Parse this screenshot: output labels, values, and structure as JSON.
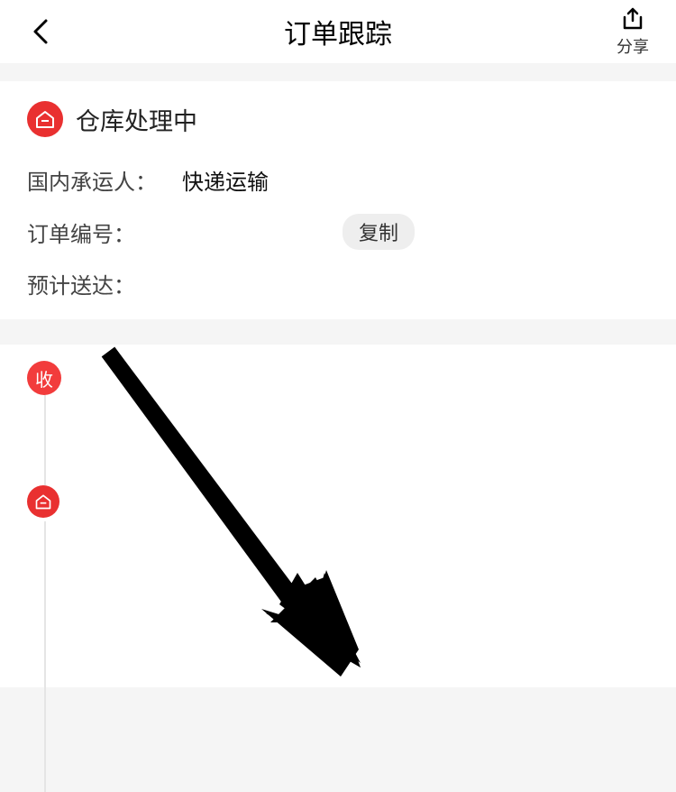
{
  "header": {
    "title": "订单跟踪",
    "share_label": "分享"
  },
  "status": {
    "text": "仓库处理中"
  },
  "info": {
    "carrier_label": "国内承运人：",
    "carrier_value": "快递运输",
    "order_no_label": "订单编号：",
    "order_no_value": "",
    "copy_label": "复制",
    "eta_label": "预计送达："
  },
  "timeline": {
    "received_label": "收"
  }
}
